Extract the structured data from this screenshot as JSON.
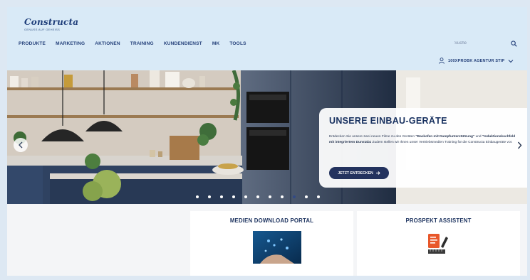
{
  "brand": {
    "name": "Constructa",
    "tagline": "GENUSS AUF GEHEISS"
  },
  "nav": {
    "items": [
      {
        "label": "PRODUKTE",
        "name": "nav-produkte"
      },
      {
        "label": "MARKETING",
        "name": "nav-marketing"
      },
      {
        "label": "AKTIONEN",
        "name": "nav-aktionen"
      },
      {
        "label": "TRAINING",
        "name": "nav-training"
      },
      {
        "label": "KUNDENDIENST",
        "name": "nav-kundendienst"
      },
      {
        "label": "MK",
        "name": "nav-mk"
      },
      {
        "label": "TOOLS",
        "name": "nav-tools"
      }
    ]
  },
  "search": {
    "placeholder": "Suche",
    "icon": "search-icon"
  },
  "account": {
    "label": "100XPROBK AGENTUR STIP",
    "icon": "user-icon",
    "chevron": "chevron-down-icon"
  },
  "hero": {
    "title": "UNSERE EINBAU-GERÄTE",
    "text_1": "Entdecken Sie unsere zwei neuen Filme zu den Geräten ",
    "text_bold_1": "\"Backofen mit Dampfunterstützung\"",
    "text_2": " und ",
    "text_bold_2": "\"Induktionskochfeld mit integriertem Dunstabz",
    "text_3": "Zudem stellen wir Ihnen unser Vertriebsmedien Training für die Constructa Einbaugeräte vor.",
    "cta_label": "JETZT ENTDECKEN",
    "slide_count": 11,
    "active_slide": 8
  },
  "tiles": [
    {
      "title": "MEDIEN DOWNLOAD PORTAL",
      "icon": "tablet-image"
    },
    {
      "title": "PROSPEKT ASSISTENT",
      "icon": "brochure-pen-icon"
    }
  ],
  "colors": {
    "header_bg": "#d9eaf7",
    "brand_blue": "#1f3e7a",
    "cta_bg": "#23325e",
    "cabinet_blue": "#2a3b57"
  }
}
